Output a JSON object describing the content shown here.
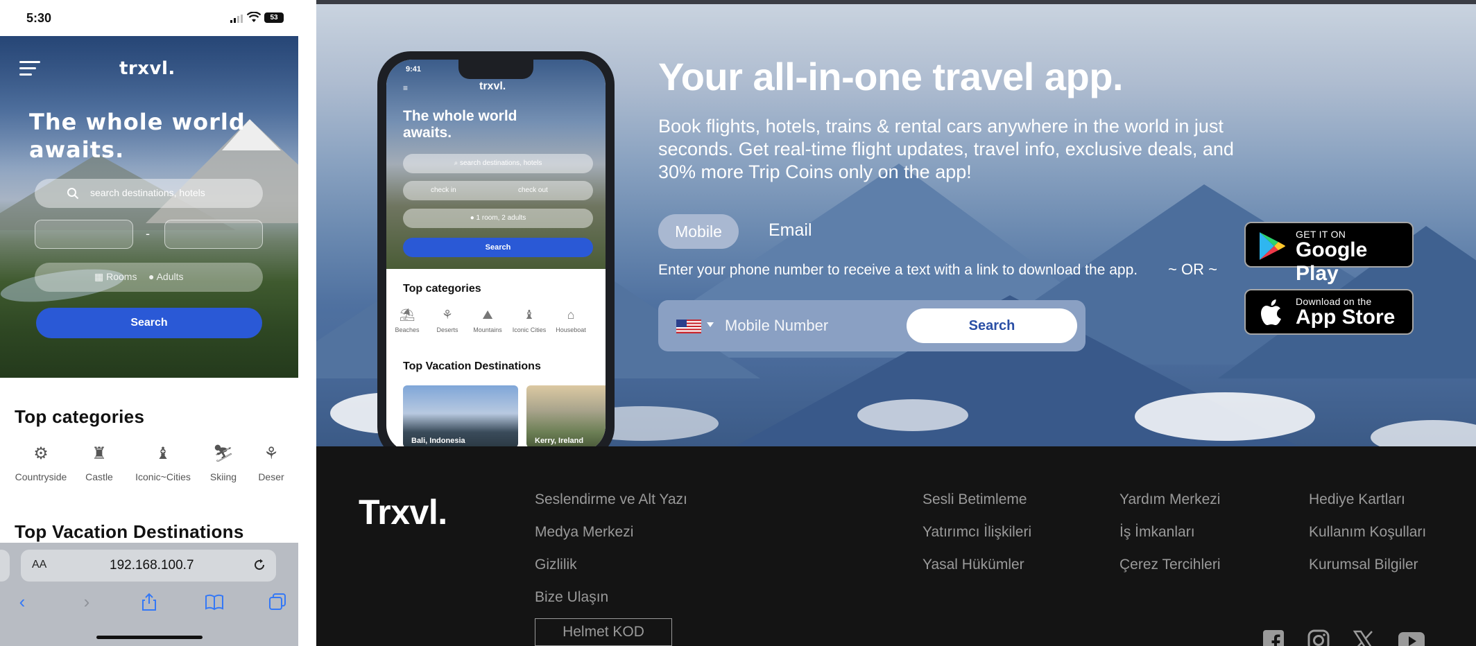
{
  "mobile": {
    "status": {
      "time": "5:30",
      "battery": "53"
    },
    "app": {
      "logo": "trxvl.",
      "headline": "The whole world awaits.",
      "search_placeholder": "search destinations, hotels",
      "date_separator": "-",
      "rooms_label": "Rooms",
      "adults_label": "Adults",
      "search_button": "Search",
      "top_categories_title": "Top categories",
      "categories": [
        {
          "label": "Countryside",
          "icon": "tractor-icon"
        },
        {
          "label": "Castle",
          "icon": "castle-icon"
        },
        {
          "label": "Iconic~Cities",
          "icon": "tower-icon"
        },
        {
          "label": "Skiing",
          "icon": "skier-icon"
        },
        {
          "label": "Deser",
          "icon": "cactus-icon"
        }
      ],
      "top_vacation_title": "Top Vacation Destinations"
    },
    "browser": {
      "text_size_label": "AA",
      "url": "192.168.100.7"
    }
  },
  "web": {
    "mockup": {
      "time": "9:41",
      "logo": "trxvl.",
      "headline": "The whole world awaits.",
      "search_placeholder": "search destinations, hotels",
      "check_in": "check in",
      "check_out": "check out",
      "guests": "1 room, 2 adults",
      "search_button": "Search",
      "top_categories_title": "Top categories",
      "categories": [
        "Beaches",
        "Deserts",
        "Mountains",
        "Iconic Cities",
        "Houseboat"
      ],
      "top_vacation_title": "Top Vacation Destinations",
      "destinations": [
        "Bali, Indonesia",
        "Kerry, Ireland"
      ]
    },
    "headline": "Your all-in-one travel app.",
    "subtext": "Book flights, hotels, trains & rental cars anywhere in the world in just seconds. Get real-time flight updates, travel info, exclusive deals, and 30% more Trip Coins only on the app!",
    "tabs": {
      "mobile": "Mobile",
      "email": "Email"
    },
    "hint": "Enter your phone number to receive a text with a link to download the app.",
    "or_label": "~ OR ~",
    "phone_placeholder": "Mobile Number",
    "search_button": "Search",
    "google_play": {
      "small": "GET IT ON",
      "big": "Google Play"
    },
    "app_store": {
      "small": "Download on the",
      "big": "App Store"
    },
    "footer": {
      "logo": "Trxvl.",
      "col1": [
        "Seslendirme ve Alt Yazı",
        "Medya Merkezi",
        "Gizlilik",
        "Bize Ulaşın"
      ],
      "col2": [
        "Sesli Betimleme",
        "Yatırımcı İlişkileri",
        "Yasal Hükümler"
      ],
      "col3": [
        "Yardım Merkezi",
        "İş İmkanları",
        "Çerez Tercihleri"
      ],
      "col4": [
        "Hediye Kartları",
        "Kullanım Koşulları",
        "Kurumsal Bilgiler"
      ],
      "code_button": "Helmet KOD",
      "social": [
        "facebook-icon",
        "instagram-icon",
        "x-icon",
        "youtube-icon"
      ]
    }
  }
}
